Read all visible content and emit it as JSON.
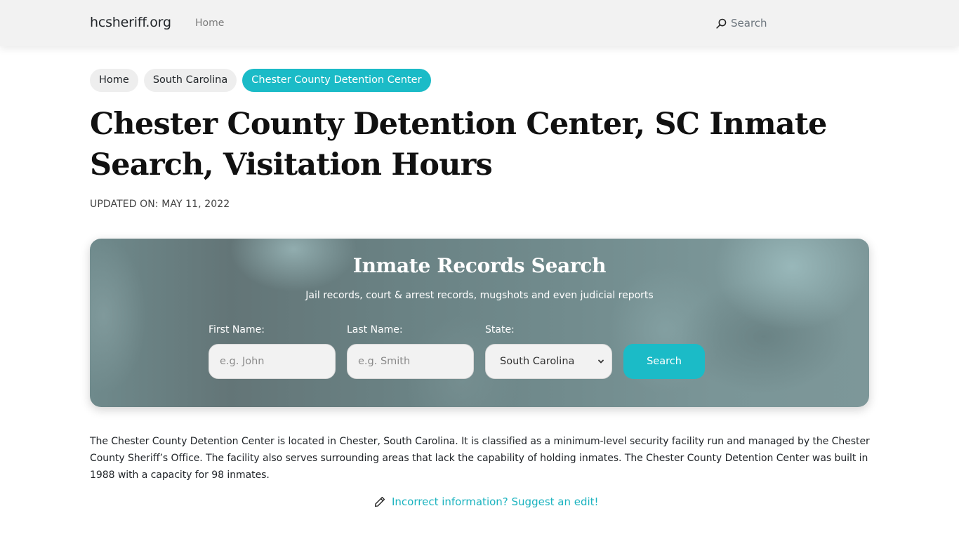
{
  "navbar": {
    "brand": "hcsheriff.org",
    "home_link": "Home",
    "search_label": "Search",
    "search_icon": "search-icon"
  },
  "breadcrumb": [
    {
      "label": "Home",
      "active": false
    },
    {
      "label": "South Carolina",
      "active": false
    },
    {
      "label": "Chester County Detention Center",
      "active": true
    }
  ],
  "page": {
    "title": "Chester County Detention Center, SC Inmate Search, Visitation Hours",
    "updated": "UPDATED ON: MAY 11, 2022"
  },
  "search_card": {
    "title": "Inmate Records Search",
    "subtitle": "Jail records, court & arrest records, mugshots and even judicial reports",
    "first_name": {
      "label": "First Name:",
      "placeholder": "e.g. John",
      "value": ""
    },
    "last_name": {
      "label": "Last Name:",
      "placeholder": "e.g. Smith",
      "value": ""
    },
    "state": {
      "label": "State:",
      "selected": "South Carolina"
    },
    "button_label": "Search"
  },
  "content": {
    "description": "The Chester County Detention Center is located in Chester, South Carolina. It is classified as a minimum-level security facility run and managed by the Chester County Sheriff’s Office. The facility also serves surrounding areas that lack the capability of holding inmates. The Chester County Detention Center was built in 1988 with a capacity for 98 inmates.",
    "suggest_edit": "Incorrect information? Suggest an edit!",
    "suggest_icon": "pencil-icon"
  },
  "colors": {
    "accent": "#1bbbc7",
    "navbar_bg": "#f2f2f2",
    "chip_bg": "#eeeeee"
  }
}
